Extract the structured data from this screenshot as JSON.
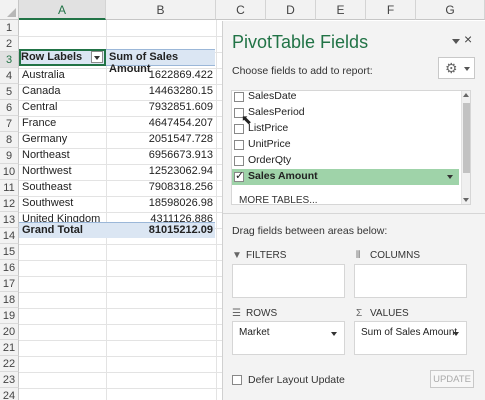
{
  "sheet": {
    "columns": [
      "A",
      "B",
      "C",
      "D",
      "E",
      "F",
      "G"
    ],
    "rows": [
      "1",
      "2",
      "3",
      "4",
      "5",
      "6",
      "7",
      "8",
      "9",
      "10",
      "11",
      "12",
      "13",
      "14",
      "15",
      "16",
      "17",
      "18",
      "19",
      "20",
      "21",
      "22",
      "23",
      "24"
    ],
    "pivot": {
      "header_labels": "Row Labels",
      "header_values": "Sum of Sales Amount",
      "rows": [
        {
          "label": "Australia",
          "value": "1622869.422"
        },
        {
          "label": "Canada",
          "value": "14463280.15"
        },
        {
          "label": "Central",
          "value": "7932851.609"
        },
        {
          "label": "France",
          "value": "4647454.207"
        },
        {
          "label": "Germany",
          "value": "2051547.728"
        },
        {
          "label": "Northeast",
          "value": "6956673.913"
        },
        {
          "label": "Northwest",
          "value": "12523062.94"
        },
        {
          "label": "Southeast",
          "value": "7908318.256"
        },
        {
          "label": "Southwest",
          "value": "18598026.98"
        },
        {
          "label": "United Kingdom",
          "value": "4311126.886"
        }
      ],
      "grand_total_label": "Grand Total",
      "grand_total_value": "81015212.09"
    }
  },
  "pane": {
    "title": "PivotTable Fields",
    "close_glyph": "×",
    "subtitle": "Choose fields to add to report:",
    "gear_icon": "gear-icon",
    "fields": [
      {
        "name": "SalesDate",
        "checked": false
      },
      {
        "name": "SalesPeriod",
        "checked": false
      },
      {
        "name": "ListPrice",
        "checked": false
      },
      {
        "name": "UnitPrice",
        "checked": false
      },
      {
        "name": "OrderQty",
        "checked": false
      },
      {
        "name": "Sales Amount",
        "checked": true
      }
    ],
    "more_tables": "MORE TABLES...",
    "drag_label": "Drag fields between areas below:",
    "areas": {
      "filters": "FILTERS",
      "columns": "COLUMNS",
      "rows": "ROWS",
      "values": "VALUES",
      "rows_item": "Market",
      "values_item": "Sum of Sales Amount"
    },
    "defer_label": "Defer Layout Update",
    "update_label": "UPDATE",
    "accent": "#217346"
  }
}
